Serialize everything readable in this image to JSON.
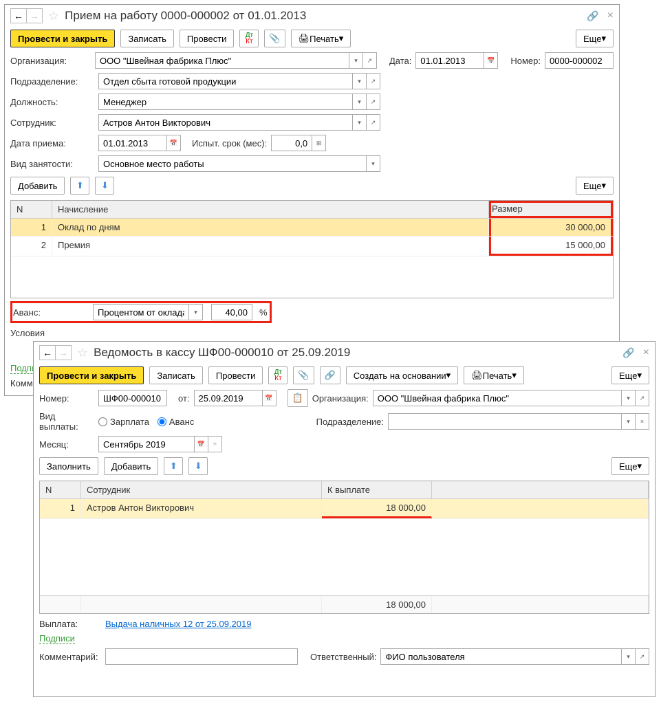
{
  "w1": {
    "title": "Прием на работу 0000-000002 от 01.01.2013",
    "toolbar": {
      "submit_close": "Провести и закрыть",
      "save": "Записать",
      "submit": "Провести",
      "print": "Печать",
      "more": "Еще"
    },
    "fields": {
      "org_label": "Организация:",
      "org_value": "ООО \"Швейная фабрика Плюс\"",
      "date_label": "Дата:",
      "date_value": "01.01.2013",
      "number_label": "Номер:",
      "number_value": "0000-000002",
      "dept_label": "Подразделение:",
      "dept_value": "Отдел сбыта готовой продукции",
      "position_label": "Должность:",
      "position_value": "Менеджер",
      "employee_label": "Сотрудник:",
      "employee_value": "Астров Антон Викторович",
      "hire_date_label": "Дата приема:",
      "hire_date_value": "01.01.2013",
      "probation_label": "Испыт. срок (мес):",
      "probation_value": "0,0",
      "employment_label": "Вид занятости:",
      "employment_value": "Основное место работы",
      "add": "Добавить",
      "advance_label": "Аванс:",
      "advance_type": "Процентом от оклада",
      "advance_value": "40,00",
      "advance_pct": "%",
      "conditions_label": "Условия",
      "signatures": "Подписи",
      "comment_label": "Коммент"
    },
    "table": {
      "col_n": "N",
      "col_accrual": "Начисление",
      "col_size": "Размер",
      "rows": [
        {
          "n": "1",
          "name": "Оклад по дням",
          "size": "30 000,00"
        },
        {
          "n": "2",
          "name": "Премия",
          "size": "15 000,00"
        }
      ]
    }
  },
  "w2": {
    "title": "Ведомость в кассу ШФ00-000010 от 25.09.2019",
    "toolbar": {
      "submit_close": "Провести и закрыть",
      "save": "Записать",
      "submit": "Провести",
      "create_based": "Создать на основании",
      "print": "Печать",
      "more": "Еще"
    },
    "fields": {
      "number_label": "Номер:",
      "number_value": "ШФ00-000010",
      "from_label": "от:",
      "from_value": "25.09.2019",
      "org_label": "Организация:",
      "org_value": "ООО \"Швейная фабрика Плюс\"",
      "pay_type_label": "Вид выплаты:",
      "pay_type_salary": "Зарплата",
      "pay_type_advance": "Аванс",
      "dept_label": "Подразделение:",
      "month_label": "Месяц:",
      "month_value": "Сентябрь 2019",
      "fill": "Заполнить",
      "add": "Добавить",
      "payment_label": "Выплата:",
      "payment_link": "Выдача наличных 12 от 25.09.2019",
      "signatures": "Подписи",
      "comment_label": "Комментарий:",
      "responsible_label": "Ответственный:",
      "responsible_value": "ФИО пользователя"
    },
    "table": {
      "col_n": "N",
      "col_employee": "Сотрудник",
      "col_topay": "К выплате",
      "rows": [
        {
          "n": "1",
          "name": "Астров Антон Викторович",
          "pay": "18 000,00"
        }
      ],
      "total": "18 000,00"
    }
  }
}
